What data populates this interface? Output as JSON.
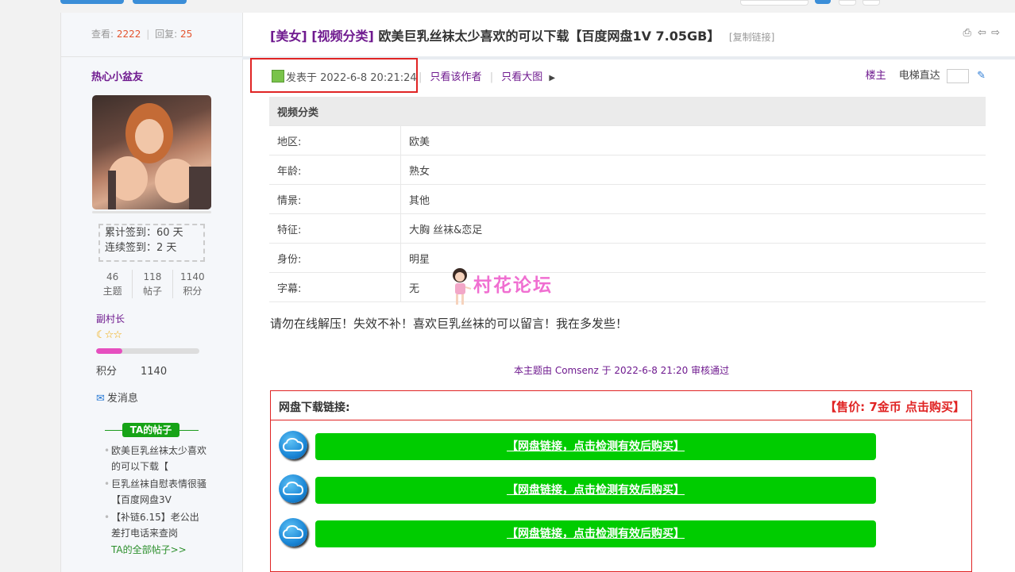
{
  "colors": {
    "accent_purple": "#6f1a8f",
    "highlight_red": "#e02424",
    "button_green": "#00cc00",
    "count_orange": "#e4542e",
    "link_green": "#2c8f2c"
  },
  "thread": {
    "views_label": "查看:",
    "views": "2222",
    "replies_label": "回复:",
    "replies": "25",
    "category_1": "[美女]",
    "category_2": "[视频分类]",
    "title": "欧美巨乳丝袜太少喜欢的可以下载【百度网盘1V 7.05GB】",
    "copy_link": "[复制链接]",
    "icons": [
      "print-icon",
      "prev-icon",
      "next-icon"
    ]
  },
  "author": {
    "name": "热心小盆友",
    "sign_total": "累计签到：60 天",
    "sign_streak": "连续签到：2 天",
    "counts": [
      {
        "value": "46",
        "label": "主题"
      },
      {
        "value": "118",
        "label": "帖子"
      },
      {
        "value": "1140",
        "label": "积分"
      }
    ],
    "rank": "副村长",
    "level_progress": 0.25,
    "score_label": "积分",
    "score": "1140",
    "message": "发消息",
    "ta_posts_title": "TA的帖子",
    "ta_posts": [
      "欧美巨乳丝袜太少喜欢的可以下载【",
      "巨乳丝袜自慰表情很骚【百度网盘3V",
      "【补链6.15】老公出差打电话来查岗"
    ],
    "ta_all": "TA的全部帖子>>"
  },
  "post": {
    "posted_at": "发表于 2022-6-8 20:21:24",
    "only_author": "只看该作者",
    "only_big": "只看大图",
    "floor": "楼主",
    "elevator": "电梯直达",
    "table_title": "视频分类",
    "table_rows": [
      {
        "k": "地区:",
        "v": "欧美"
      },
      {
        "k": "年龄:",
        "v": "熟女"
      },
      {
        "k": "情景:",
        "v": "其他"
      },
      {
        "k": "特征:",
        "v": "大胸 丝袜&恋足"
      },
      {
        "k": "身份:",
        "v": "明星"
      },
      {
        "k": "字幕:",
        "v": "无"
      }
    ],
    "watermark": "村花论坛",
    "body": "请勿在线解压！失效不补！喜欢巨乳丝袜的可以留言！我在多发些！",
    "approval": "本主题由 Comsenz 于 2022-6-8 21:20 审核通过"
  },
  "download": {
    "title": "网盘下载链接:",
    "price": "【售价:  7金币 点击购买】",
    "links": [
      "【网盘链接，点击检测有效后购买】",
      "【网盘链接，点击检测有效后购买】",
      "【网盘链接，点击检测有效后购买】"
    ]
  }
}
